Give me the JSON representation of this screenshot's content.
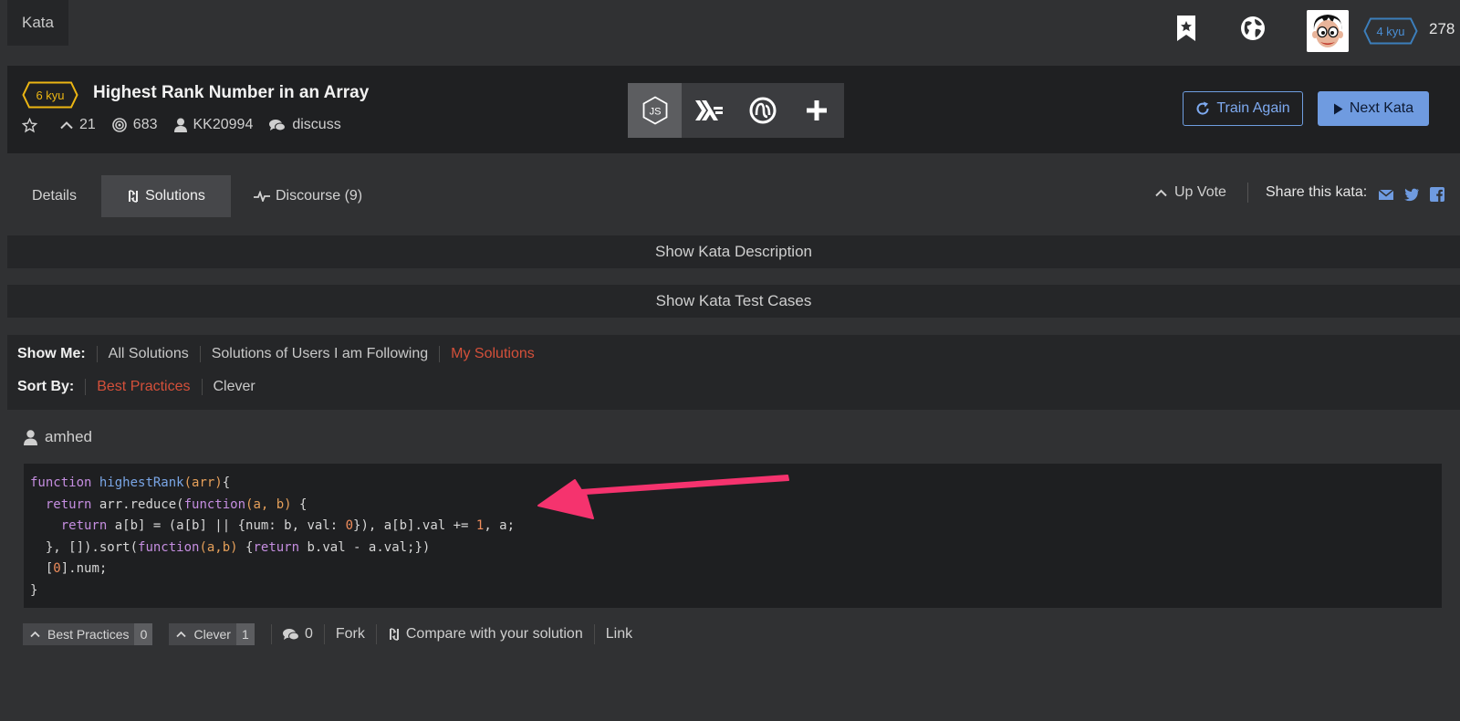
{
  "topbar": {
    "kata_tab": "Kata",
    "user_rank": "4 kyu",
    "honor": "278"
  },
  "kata": {
    "rank": "6 kyu",
    "title": "Highest Rank Number in an Array",
    "votes": "21",
    "completions": "683",
    "author": "KK20994",
    "discuss": "discuss",
    "languages": [
      "javascript-icon",
      "haskell-icon",
      "clojure-icon",
      "add-language-icon"
    ],
    "train_again": "Train Again",
    "next_kata": "Next Kata"
  },
  "tabs": {
    "details": "Details",
    "solutions": "Solutions",
    "discourse": "Discourse (9)"
  },
  "share": {
    "up_vote": "Up Vote",
    "label": "Share this kata:"
  },
  "bars": {
    "description": "Show Kata Description",
    "test_cases": "Show Kata Test Cases"
  },
  "filters": {
    "show_me_label": "Show Me:",
    "show_me": [
      "All Solutions",
      "Solutions of Users I am Following",
      "My Solutions"
    ],
    "show_me_selected": "My Solutions",
    "sort_by_label": "Sort By:",
    "sort_by": [
      "Best Practices",
      "Clever"
    ],
    "sort_by_selected": "Best Practices"
  },
  "solution": {
    "user": "amhed",
    "code": [
      "function highestRank(arr){",
      "  return arr.reduce(function(a, b) {",
      "    return a[b] = (a[b] || {num: b, val: 0}), a[b].val += 1, a;",
      "  }, []).sort(function(a,b) {return b.val - a.val;})",
      "  [0].num;",
      "}"
    ],
    "best_practices_label": "Best Practices",
    "best_practices_count": "0",
    "clever_label": "Clever",
    "clever_count": "1",
    "comments": "0",
    "fork": "Fork",
    "compare": "Compare with your solution",
    "link": "Link"
  },
  "colors": {
    "accent_red": "#d4503a",
    "rank_yellow": "#ecb613",
    "rank_blue": "#3c7ebb",
    "button_blue": "#6f9be0",
    "annotation_arrow": "#f5336e"
  }
}
